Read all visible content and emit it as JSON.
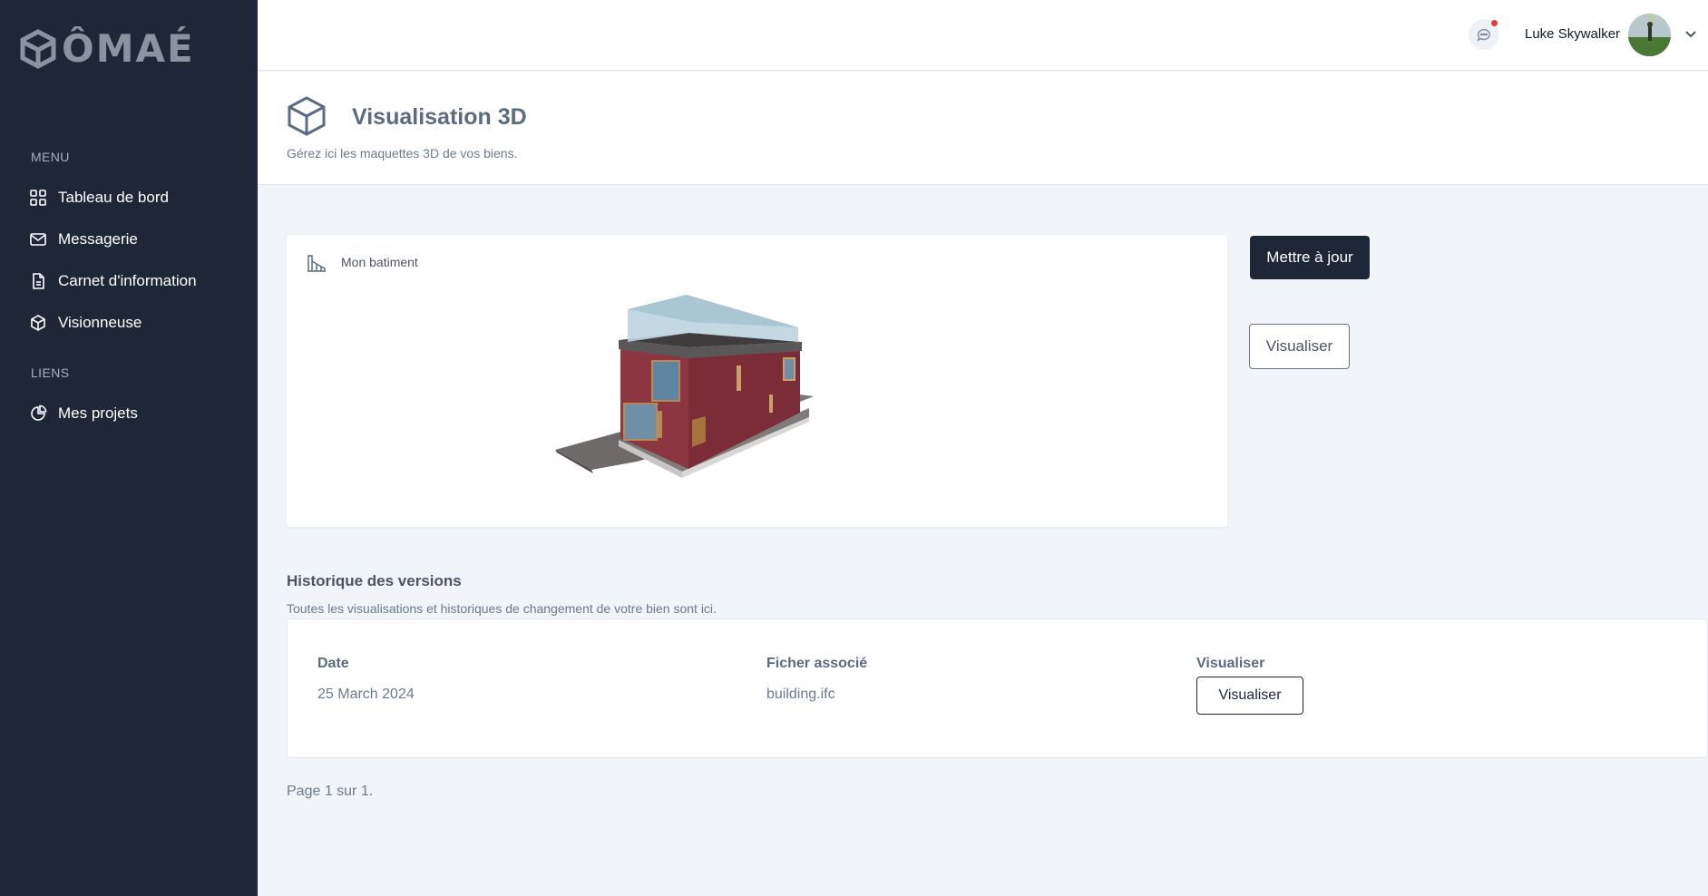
{
  "app": {
    "logo_text": "ÔMAÉ"
  },
  "sidebar": {
    "menu_heading": "MENU",
    "links_heading": "LIENS",
    "items": [
      {
        "label": "Tableau de bord",
        "icon": "grid-icon"
      },
      {
        "label": "Messagerie",
        "icon": "mail-icon"
      },
      {
        "label": "Carnet d'information",
        "icon": "document-icon"
      },
      {
        "label": "Visionneuse",
        "icon": "cube-icon"
      }
    ],
    "links": [
      {
        "label": "Mes projets",
        "icon": "pie-chart-icon"
      }
    ]
  },
  "topbar": {
    "user_name": "Luke Skywalker",
    "has_notification": true,
    "colors": {
      "notification_dot": "#e23b3b"
    }
  },
  "page": {
    "title": "Visualisation 3D",
    "subtitle": "Gérez ici les maquettes 3D de vos biens."
  },
  "viewer": {
    "label": "Mon batiment",
    "update_button": "Mettre à jour",
    "view_button": "Visualiser"
  },
  "history": {
    "title": "Historique des versions",
    "subtitle": "Toutes les visualisations et historiques de changement de votre bien sont ici.",
    "columns": [
      "Date",
      "Ficher associé",
      "Visualiser"
    ],
    "rows": [
      {
        "date": "25 March 2024",
        "file": "building.ifc",
        "action": "Visualiser"
      }
    ],
    "pagination": "Page 1 sur 1."
  },
  "colors": {
    "sidebar_bg": "#1e2738",
    "page_bg": "#f1f4f8",
    "primary_button": "#1e2738"
  }
}
